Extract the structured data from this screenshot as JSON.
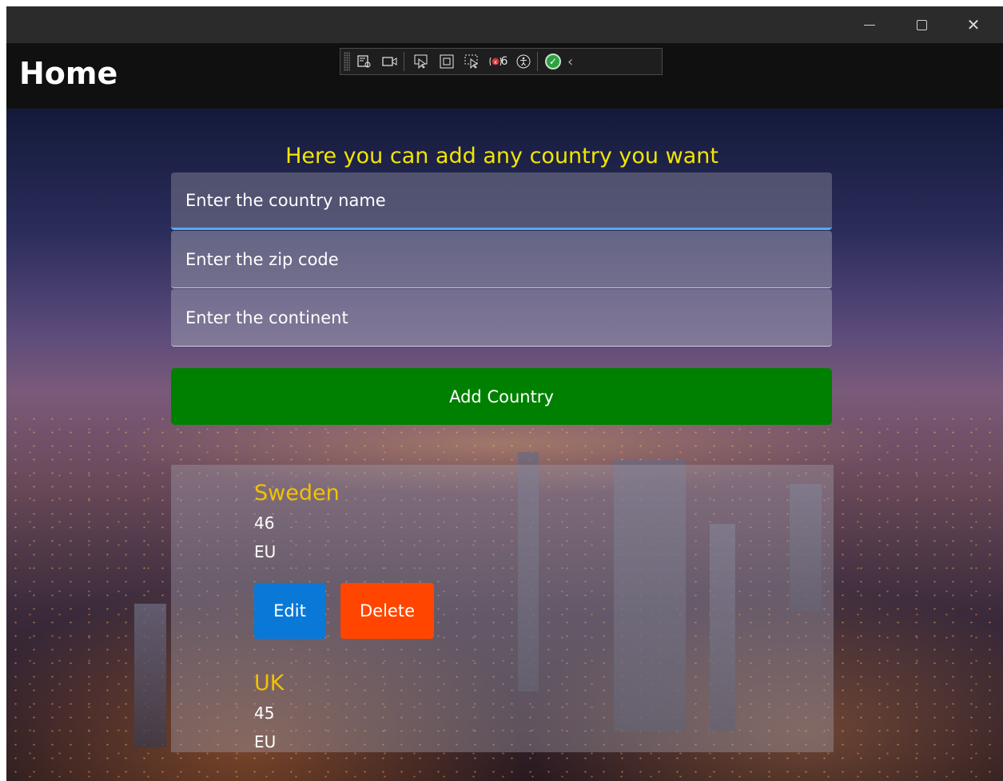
{
  "window": {
    "controls": {
      "minimize": "—",
      "maximize": "",
      "close": "✕"
    }
  },
  "header": {
    "title": "Home"
  },
  "debug_toolbar": {
    "error_count": "6"
  },
  "page": {
    "heading": "Here you can add any country you want"
  },
  "form": {
    "country_placeholder": "Enter the country name",
    "zip_placeholder": "Enter the zip code",
    "continent_placeholder": "Enter the continent",
    "add_button": "Add Country"
  },
  "countries": [
    {
      "name": "Sweden",
      "zip": "46",
      "continent": "EU",
      "edit_label": "Edit",
      "delete_label": "Delete"
    },
    {
      "name": "UK",
      "zip": "45",
      "continent": "EU"
    }
  ],
  "colors": {
    "heading": "#f2e600",
    "country_name": "#f2c200",
    "add_button": "#008000",
    "edit_button": "#0a78d7",
    "delete_button": "#ff4500",
    "focus_underline": "#5aa9f0"
  }
}
